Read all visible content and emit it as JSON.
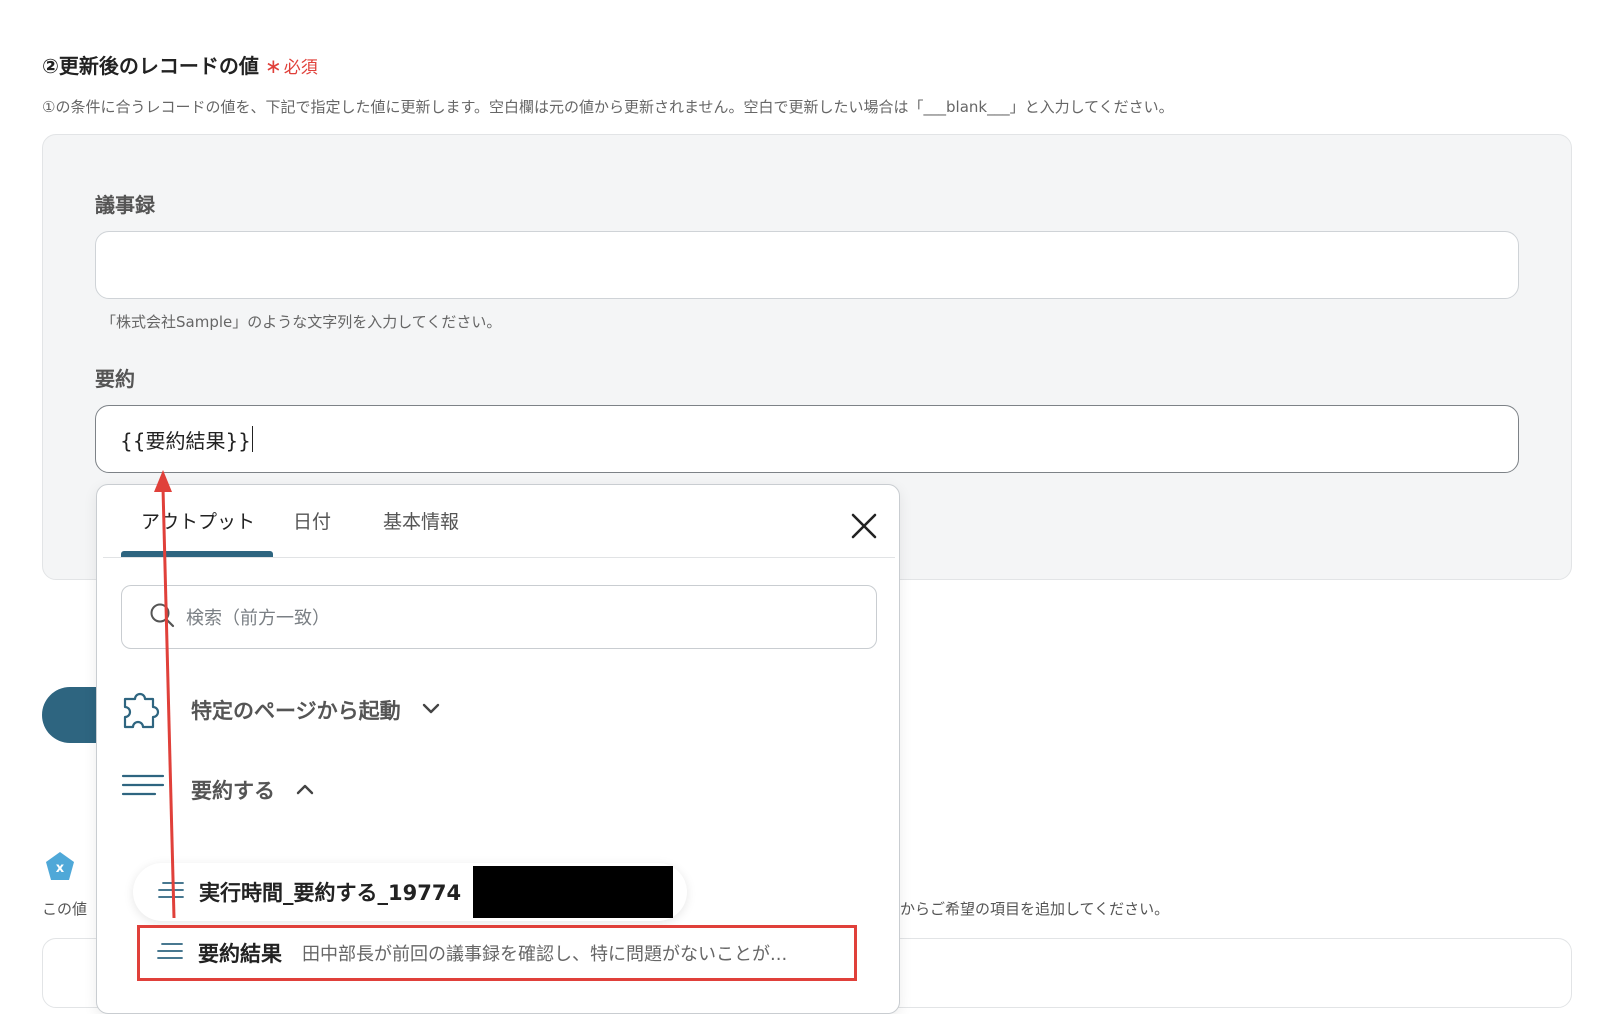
{
  "section": {
    "title": "②更新後のレコードの値",
    "required_mark": "∗",
    "required_label": "必須",
    "description": "①の条件に合うレコードの値を、下記で指定した値に更新します。空白欄は元の値から更新されません。空白で更新したい場合は「___blank___」と入力してください。"
  },
  "fields": {
    "minutes": {
      "label": "議事録",
      "value": "",
      "hint": "「株式会社Sample」のような文字列を入力してください。"
    },
    "summary": {
      "label": "要約",
      "value": "{{要約結果}}"
    }
  },
  "dropdown": {
    "tabs": [
      {
        "label": "アウトプット",
        "selected": true
      },
      {
        "label": "日付",
        "selected": false
      },
      {
        "label": "基本情報",
        "selected": false
      }
    ],
    "search_placeholder": "検索（前方一致）",
    "groups": [
      {
        "label": "特定のページから起動",
        "icon": "puzzle-icon",
        "expanded": false
      },
      {
        "label": "要約する",
        "icon": "lines-icon",
        "expanded": true
      }
    ],
    "items": [
      {
        "name": "実行時間_要約する_19774"
      },
      {
        "name": "要約結果",
        "preview": "田中部長が前回の議事録を確認し、特に問題がないことが..."
      }
    ]
  },
  "below": {
    "text_left": "この値",
    "text_right": "からご希望の項目を追加してください。"
  },
  "colors": {
    "accent": "#2e6580",
    "required": "#e0403a",
    "highlight_border": "#e0403a",
    "badge": "#4fa8d8"
  }
}
